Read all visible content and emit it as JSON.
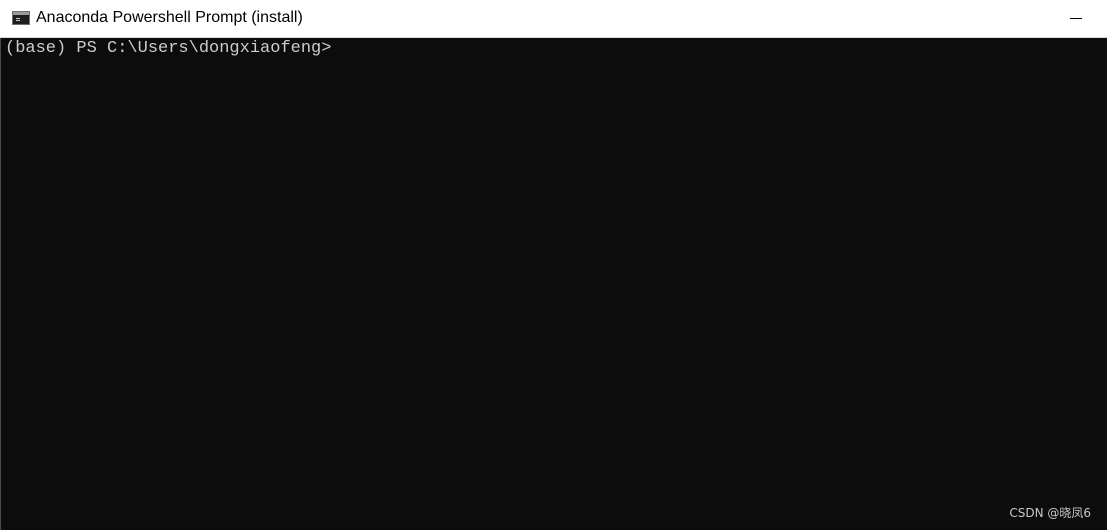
{
  "window": {
    "title": "Anaconda Powershell Prompt (install)",
    "icon": "console-icon",
    "controls": [
      "minimize-icon"
    ]
  },
  "console": {
    "prompt": "(base) PS C:\\Users\\dongxiaofeng>"
  },
  "watermark": "CSDN @晓凤6",
  "colors": {
    "titlebar": "#ffffff",
    "console_bg": "#0c0c0c",
    "console_text": "#cccccc"
  }
}
